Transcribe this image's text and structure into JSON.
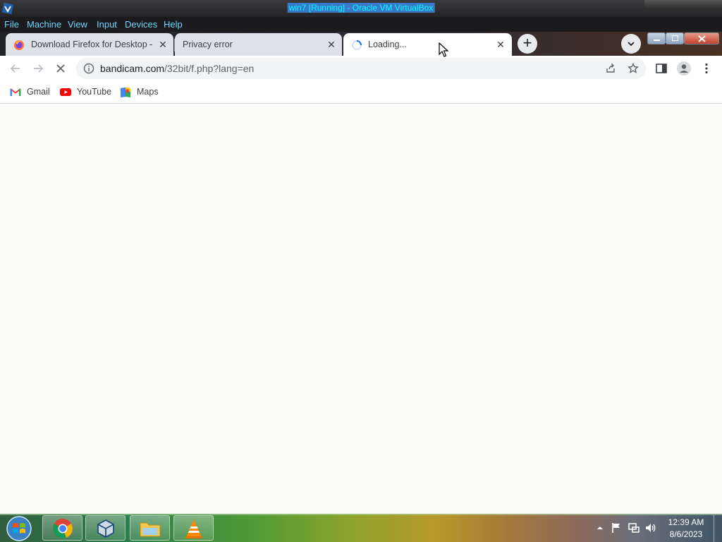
{
  "vbox": {
    "title": "win7 [Running] - Oracle VM VirtualBox",
    "menu": [
      "File",
      "Machine",
      "View",
      "Input",
      "Devices",
      "Help"
    ]
  },
  "tabs": [
    {
      "title": "Download Firefox for Desktop —",
      "icon": "firefox-icon",
      "close": "✕"
    },
    {
      "title": "Privacy error",
      "icon": "",
      "close": "✕"
    },
    {
      "title": "Loading...",
      "icon": "spinner-icon",
      "close": "✕"
    }
  ],
  "toolbar": {
    "url_host": "bandicam.com",
    "url_path": "/32bit/f.php?lang=en"
  },
  "bookmarks": [
    {
      "label": "Gmail",
      "icon": "gmail-icon"
    },
    {
      "label": "YouTube",
      "icon": "youtube-icon"
    },
    {
      "label": "Maps",
      "icon": "maps-icon"
    }
  ],
  "newtab_symbol": "+",
  "taskbar": {
    "apps": [
      "chrome-icon",
      "virtualbox-icon",
      "explorer-icon",
      "vlc-icon"
    ],
    "time": "12:39 AM",
    "date": "8/6/2023"
  },
  "colors": {
    "menu_text": "#6fd4ff",
    "title_text": "#00ffff",
    "accent_blue": "#1a73e8"
  }
}
